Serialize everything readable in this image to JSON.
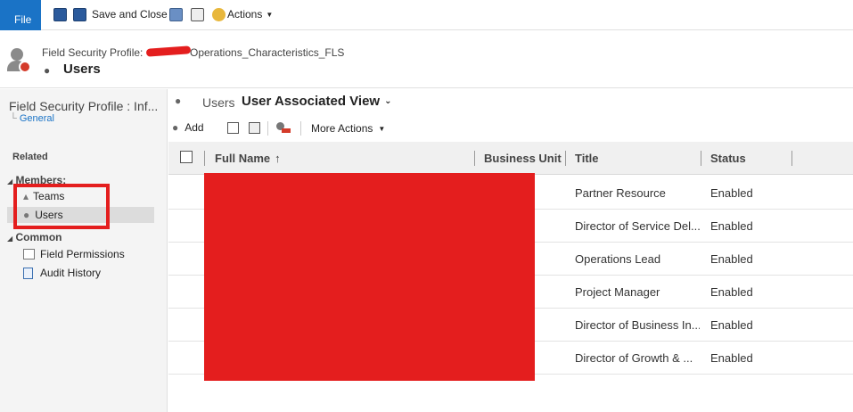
{
  "toolbar": {
    "file_label": "File",
    "save_close_label": "Save and Close",
    "actions_label": "Actions"
  },
  "header": {
    "entity_label": "Field Security Profile:",
    "profile_name": "Operations_Characteristics_FLS",
    "title": "Users"
  },
  "sidebar": {
    "profile_title": "Field Security Profile : Inf...",
    "general_link": "General",
    "related_label": "Related",
    "members_label": "Members:",
    "teams_label": "Teams",
    "users_label": "Users",
    "common_label": "Common",
    "field_permissions_label": "Field Permissions",
    "audit_history_label": "Audit History"
  },
  "view": {
    "entity_label": "Users",
    "view_name": "User Associated View",
    "add_label": "Add",
    "more_actions_label": "More Actions"
  },
  "grid": {
    "columns": [
      "Full Name",
      "Business Unit",
      "Title",
      "Status"
    ],
    "rows": [
      {
        "title": "Partner Resource",
        "status": "Enabled"
      },
      {
        "title": "Director of Service Del...",
        "status": "Enabled"
      },
      {
        "title": "Operations Lead",
        "status": "Enabled"
      },
      {
        "title": "Project Manager",
        "status": "Enabled"
      },
      {
        "title": "Director of Business In...",
        "status": "Enabled"
      },
      {
        "title": "Director of Growth & ...",
        "status": "Enabled"
      }
    ]
  },
  "colors": {
    "file_button": "#1a73c6",
    "redaction": "#e41e1e",
    "link": "#1a73c6"
  }
}
